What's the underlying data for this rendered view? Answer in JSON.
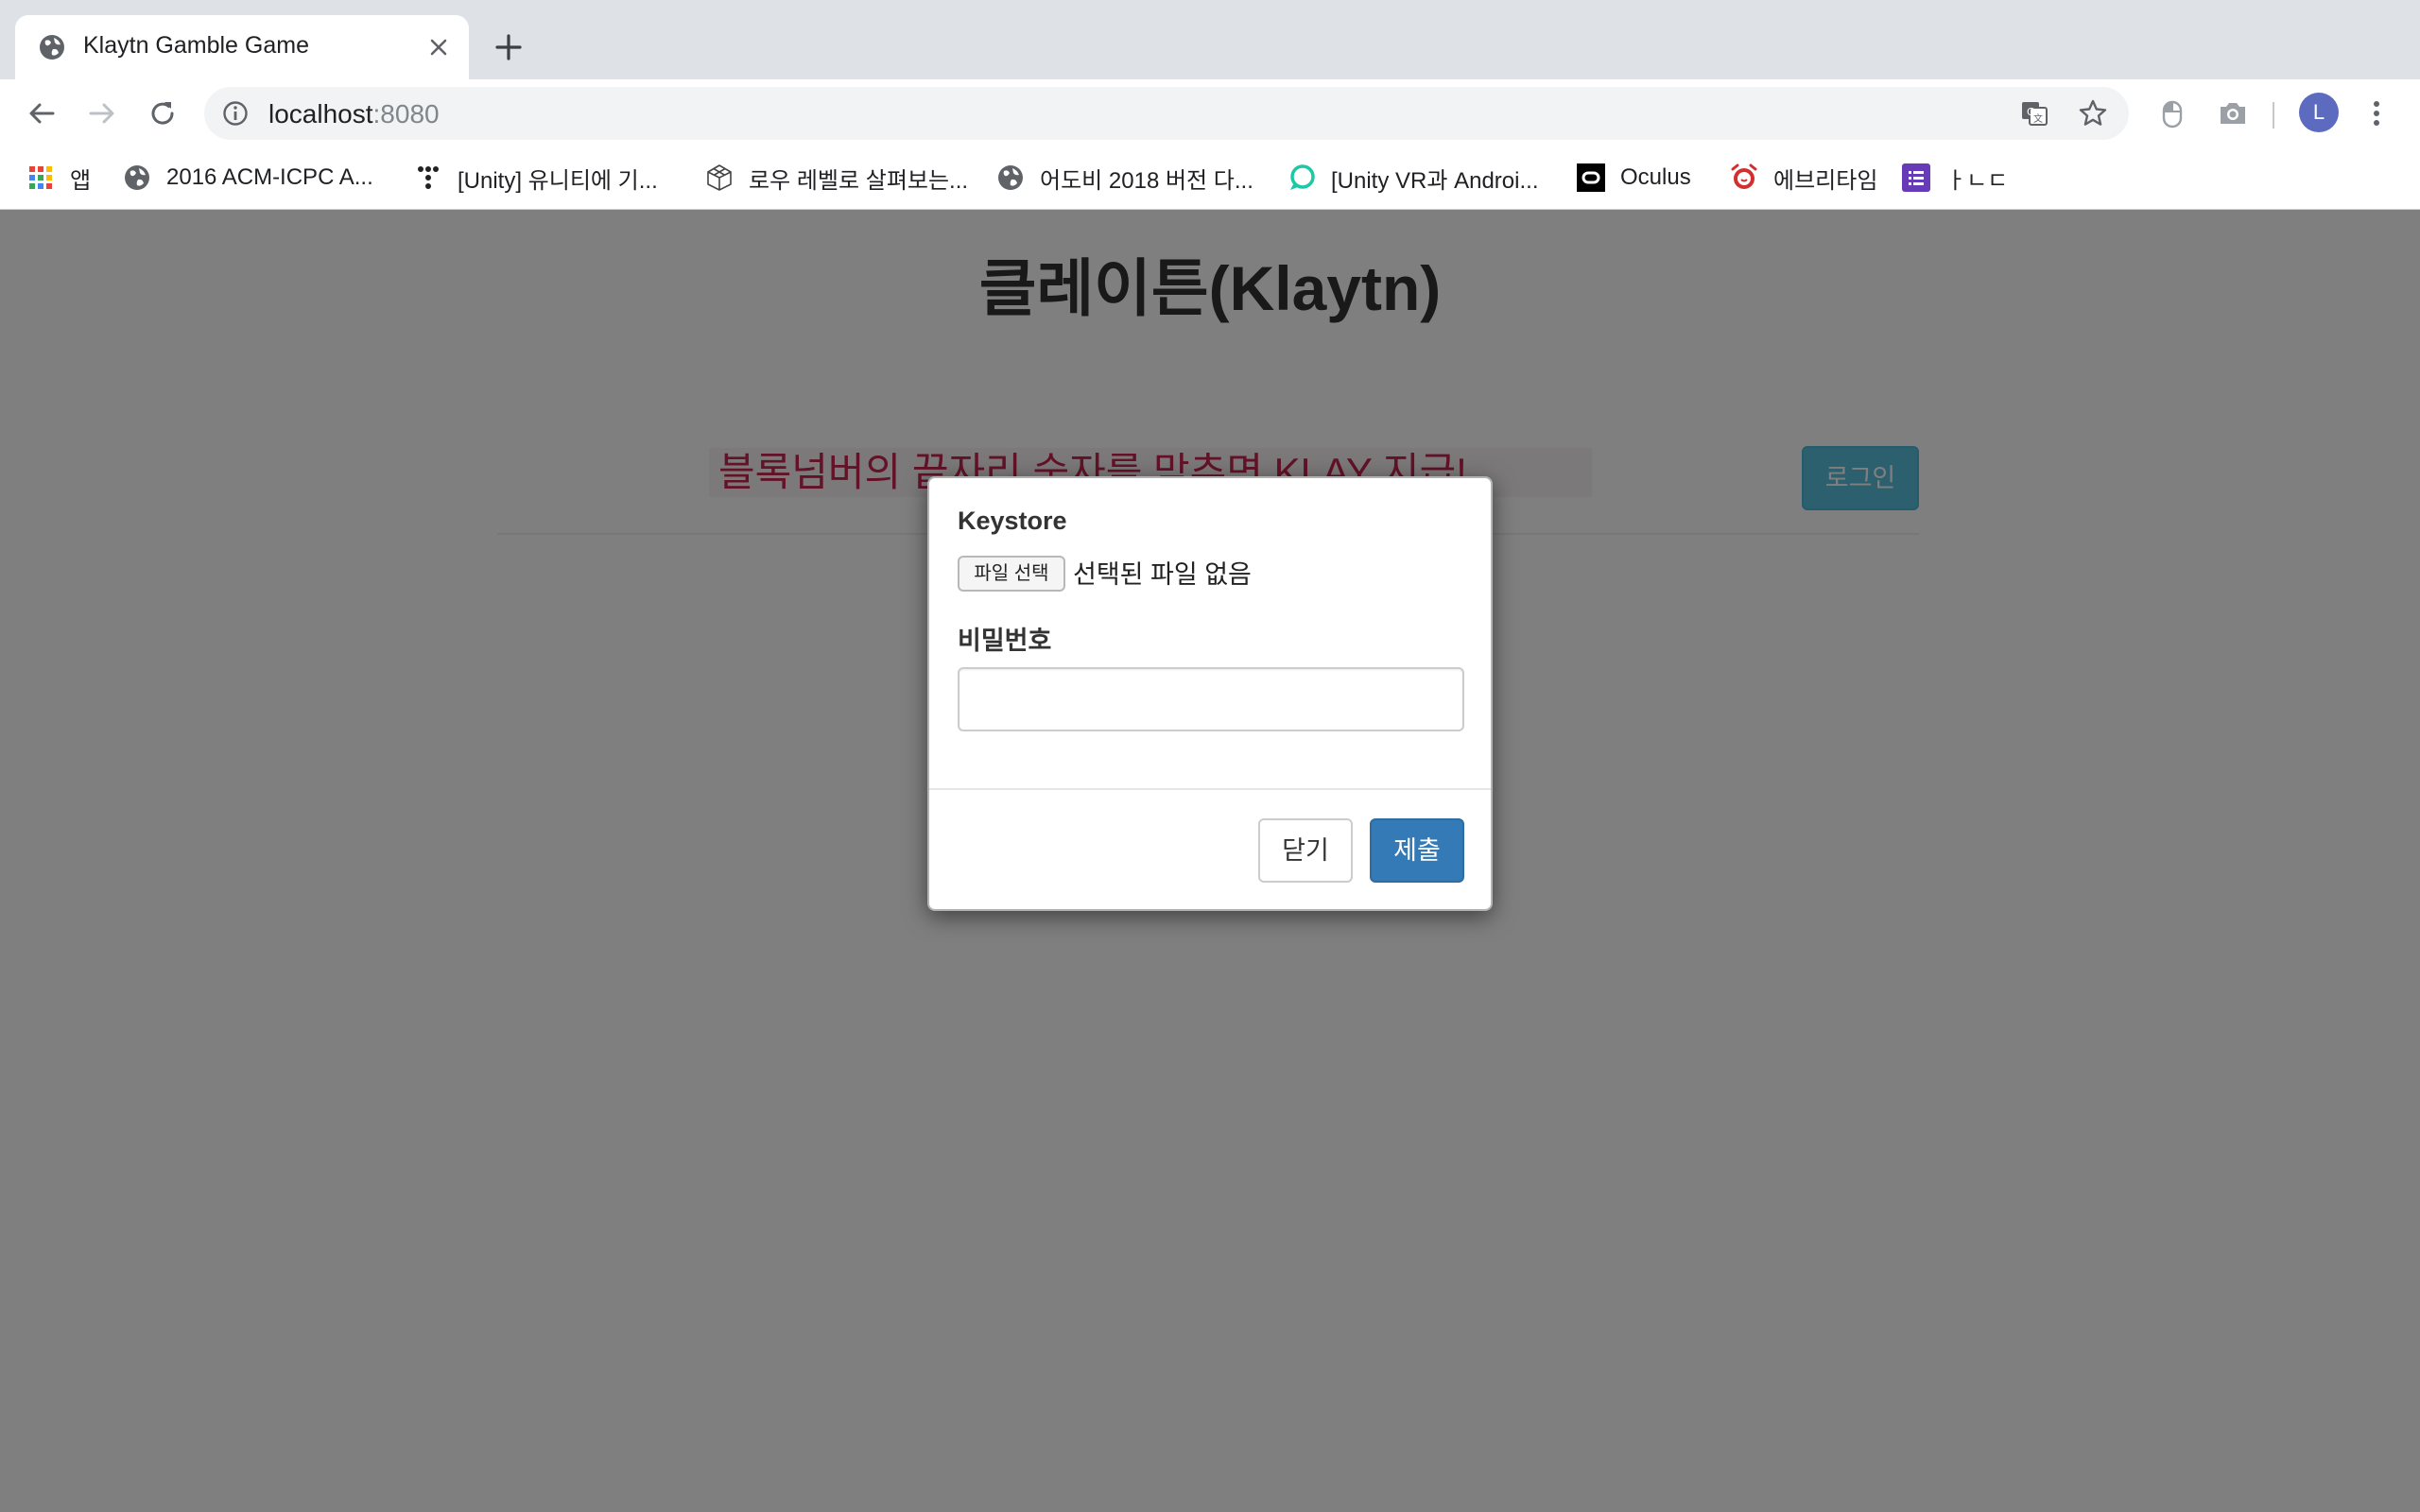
{
  "browser": {
    "tab": {
      "title": "Klaytn Gamble Game"
    },
    "address_bar": {
      "host": "localhost",
      "port": ":8080"
    },
    "avatar_initial": "L",
    "bookmarks": [
      {
        "label": "앱",
        "icon": "apps-grid-icon"
      },
      {
        "label": "2016 ACM-ICPC A...",
        "icon": "globe-icon"
      },
      {
        "label": "[Unity] 유니티에 기...",
        "icon": "tistory-icon"
      },
      {
        "label": "로우 레벨로 살펴보는...",
        "icon": "cube-icon"
      },
      {
        "label": "어도비 2018 버전 다...",
        "icon": "globe-icon"
      },
      {
        "label": "[Unity VR과 Androi...",
        "icon": "speech-bubble-icon"
      },
      {
        "label": "Oculus",
        "icon": "oculus-icon"
      },
      {
        "label": "에브리타임",
        "icon": "alarm-clock-icon"
      },
      {
        "label": "ㅏㄴㄷ",
        "icon": "list-icon"
      }
    ]
  },
  "page": {
    "title": "클레이튼(Klaytn)",
    "banner": "블록넘버의 끝자리 숫자를 맞추면 KLAY 지급!",
    "login_button": "로그인"
  },
  "modal": {
    "keystore_label": "Keystore",
    "file_button": "파일 선택",
    "file_status": "선택된 파일 없음",
    "password_label": "비밀번호",
    "password_value": "",
    "close_button": "닫기",
    "submit_button": "제출"
  },
  "colors": {
    "banner_text": "#c7254e",
    "banner_bg": "#f9f2f4",
    "login_button": "#5bc0de",
    "submit_button": "#337ab7",
    "backdrop": "rgba(0,0,0,0.5)"
  }
}
